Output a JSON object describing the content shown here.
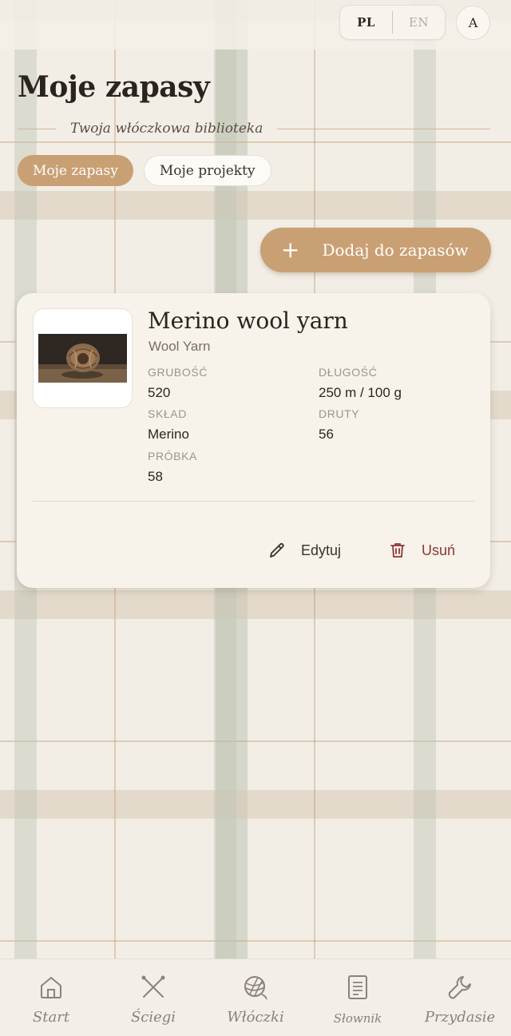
{
  "header": {
    "languages": [
      {
        "code": "PL",
        "active": true
      },
      {
        "code": "EN",
        "active": false
      }
    ],
    "avatar_initial": "A"
  },
  "page": {
    "title": "Moje zapasy",
    "subtitle": "Twoja włóczkowa biblioteka"
  },
  "tabs": [
    {
      "label": "Moje zapasy",
      "active": true
    },
    {
      "label": "Moje projekty",
      "active": false
    }
  ],
  "add_button": {
    "icon": "plus-icon",
    "label": "Dodaj do zapasów"
  },
  "yarn_card": {
    "title": "Merino wool yarn",
    "type": "Wool Yarn",
    "fields": {
      "thickness": {
        "label": "GRUBOŚĆ",
        "value": "520"
      },
      "length": {
        "label": "DŁUGOŚĆ",
        "value": "250 m / 100 g"
      },
      "composition": {
        "label": "SKŁAD",
        "value": "Merino"
      },
      "needles": {
        "label": "DRUTY",
        "value": "56"
      },
      "gauge": {
        "label": "PRÓBKA",
        "value": "58"
      }
    },
    "actions": {
      "edit": {
        "icon": "pencil-icon",
        "label": "Edytuj"
      },
      "delete": {
        "icon": "trash-icon",
        "label": "Usuń"
      }
    }
  },
  "bottom_nav": [
    {
      "icon": "home-icon",
      "label": "Start"
    },
    {
      "icon": "crossed-needles-icon",
      "label": "Ściegi"
    },
    {
      "icon": "yarn-ball-icon",
      "label": "Włóczki"
    },
    {
      "icon": "document-icon",
      "label": "Słownik"
    },
    {
      "icon": "wrench-icon",
      "label": "Przydasie"
    }
  ],
  "colors": {
    "accent": "#c9a074",
    "danger": "#8e3434",
    "card_bg": "#f7f3ea"
  }
}
